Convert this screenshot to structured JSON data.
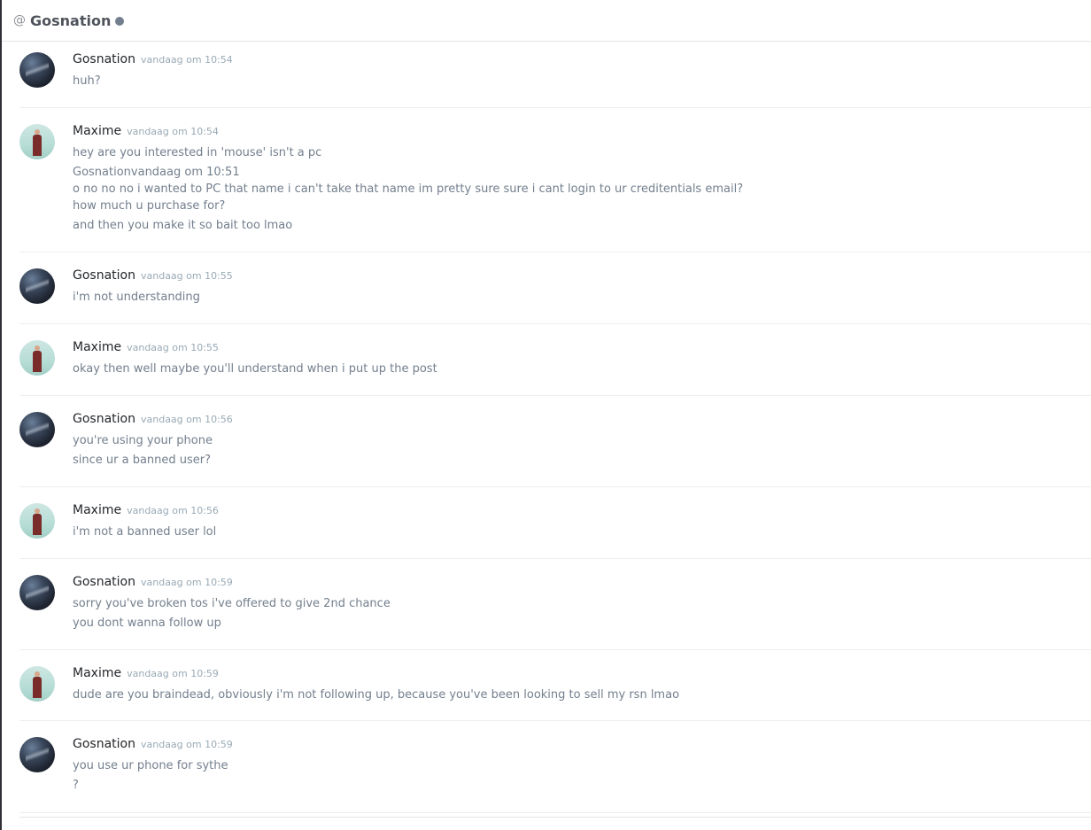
{
  "header": {
    "at_symbol": "@",
    "channel_name": "Gosnation"
  },
  "messages": [
    {
      "author": "Gosnation",
      "avatar": "dark",
      "timestamp": "vandaag om 10:54",
      "lines": [
        "huh?"
      ]
    },
    {
      "author": "Maxime",
      "avatar": "light",
      "timestamp": "vandaag om 10:54",
      "lines": [
        "hey are you interested in 'mouse' isn't a pc",
        "Gosnationvandaag om 10:51",
        "o no no no i wanted to PC that name i can't take that name im pretty sure sure i cant login to ur creditentials email?",
        "how much u purchase for?",
        "and then you make it so bait too lmao"
      ]
    },
    {
      "author": "Gosnation",
      "avatar": "dark",
      "timestamp": "vandaag om 10:55",
      "lines": [
        "i'm not understanding"
      ]
    },
    {
      "author": "Maxime",
      "avatar": "light",
      "timestamp": "vandaag om 10:55",
      "lines": [
        "okay then well maybe you'll understand when i put up the post"
      ]
    },
    {
      "author": "Gosnation",
      "avatar": "dark",
      "timestamp": "vandaag om 10:56",
      "lines": [
        "you're using your phone",
        "since ur a banned user?"
      ]
    },
    {
      "author": "Maxime",
      "avatar": "light",
      "timestamp": "vandaag om 10:56",
      "lines": [
        "i'm not a banned user lol"
      ]
    },
    {
      "author": "Gosnation",
      "avatar": "dark",
      "timestamp": "vandaag om 10:59",
      "lines": [
        "sorry you've broken tos i've offered to give 2nd chance",
        "you dont wanna follow up"
      ]
    },
    {
      "author": "Maxime",
      "avatar": "light",
      "timestamp": "vandaag om 10:59",
      "lines": [
        "dude are you braindead, obviously i'm not following up, because you've been looking to sell my rsn lmao"
      ]
    },
    {
      "author": "Gosnation",
      "avatar": "dark",
      "timestamp": "vandaag om 10:59",
      "lines": [
        "you use ur phone for sythe",
        "?"
      ]
    }
  ]
}
